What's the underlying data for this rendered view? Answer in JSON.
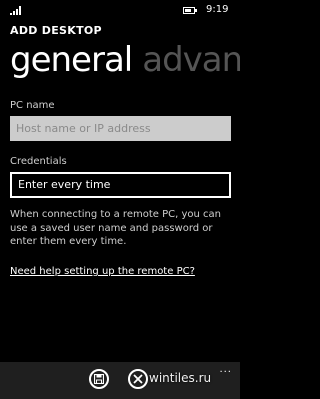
{
  "status_bar": {
    "time": "9:19",
    "signal_icon": "signal-icon",
    "battery_icon": "battery-icon"
  },
  "header": {
    "app_title": "ADD DESKTOP",
    "tabs": [
      {
        "label": "general",
        "selected": true
      },
      {
        "label": "advanced",
        "selected": false
      }
    ]
  },
  "form": {
    "pc_name": {
      "label": "PC name",
      "value": "",
      "placeholder": "Host name or IP address"
    },
    "credentials": {
      "label": "Credentials",
      "selected": "Enter every time"
    },
    "help_text": "When connecting to a remote PC, you can use a saved user name and password or enter them every time.",
    "help_link": "Need help setting up the remote PC?"
  },
  "app_bar": {
    "buttons": [
      {
        "icon": "save-icon"
      },
      {
        "icon": "cancel-icon"
      }
    ],
    "more_label": "...",
    "watermark": "wintiles.ru"
  },
  "colors": {
    "background": "#000000",
    "input_background": "#cccccc",
    "inactive_tab": "#555555",
    "app_bar": "#1f1f1f"
  }
}
